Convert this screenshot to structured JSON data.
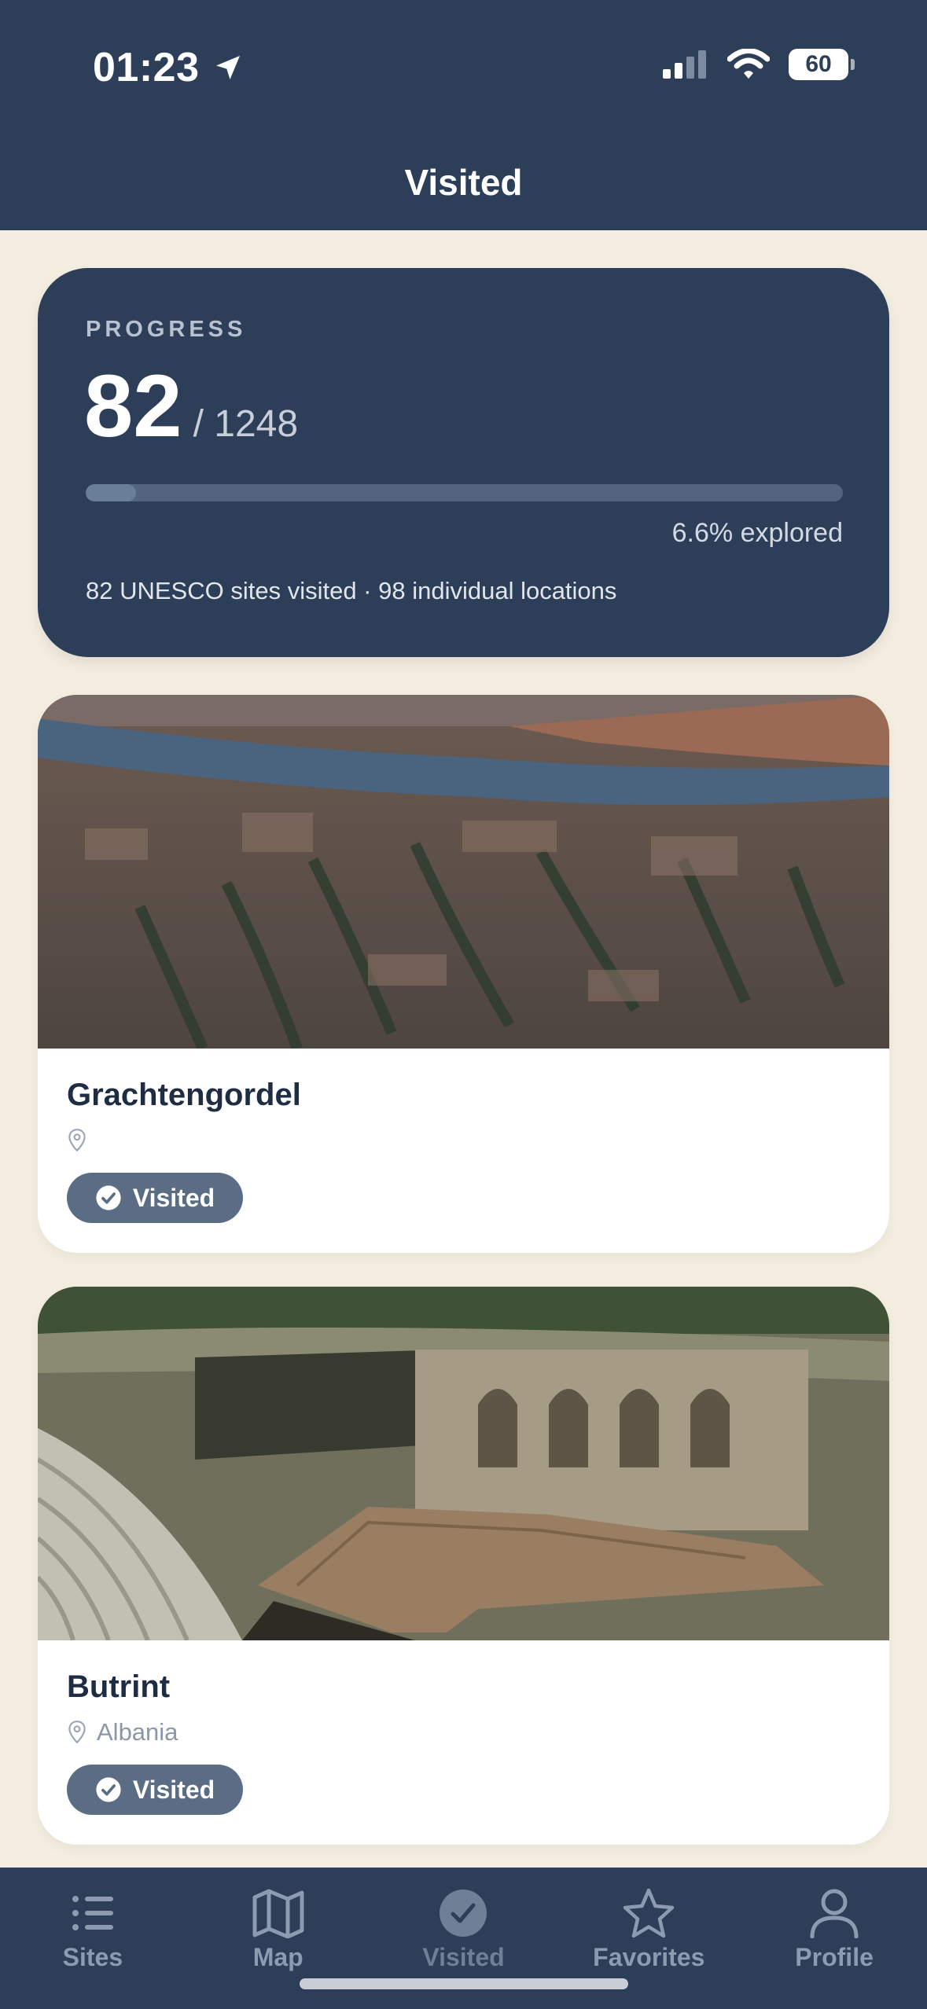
{
  "status_bar": {
    "time": "01:23",
    "battery": "60"
  },
  "header": {
    "title": "Visited"
  },
  "progress": {
    "label": "PROGRESS",
    "visited": "82",
    "total": "/ 1248",
    "fraction": 0.066,
    "percent_text": "6.6% explored",
    "summary": "82 UNESCO sites visited · 98 individual locations"
  },
  "sites": [
    {
      "name": "Grachtengordel",
      "country": "",
      "badge": "Visited",
      "image": "aerial-view-of-amsterdam-canals"
    },
    {
      "name": "Butrint",
      "country": "Albania",
      "badge": "Visited",
      "image": "ancient-theatre-ruins"
    }
  ],
  "tabs": [
    {
      "label": "Sites",
      "icon": "list-icon"
    },
    {
      "label": "Map",
      "icon": "map-icon"
    },
    {
      "label": "Visited",
      "icon": "check-circle-icon",
      "active": true
    },
    {
      "label": "Favorites",
      "icon": "star-icon"
    },
    {
      "label": "Profile",
      "icon": "person-icon"
    }
  ],
  "colors": {
    "header_bg": "#2c3e58",
    "page_bg": "#f4eee1",
    "badge_bg": "#5b6d85"
  }
}
